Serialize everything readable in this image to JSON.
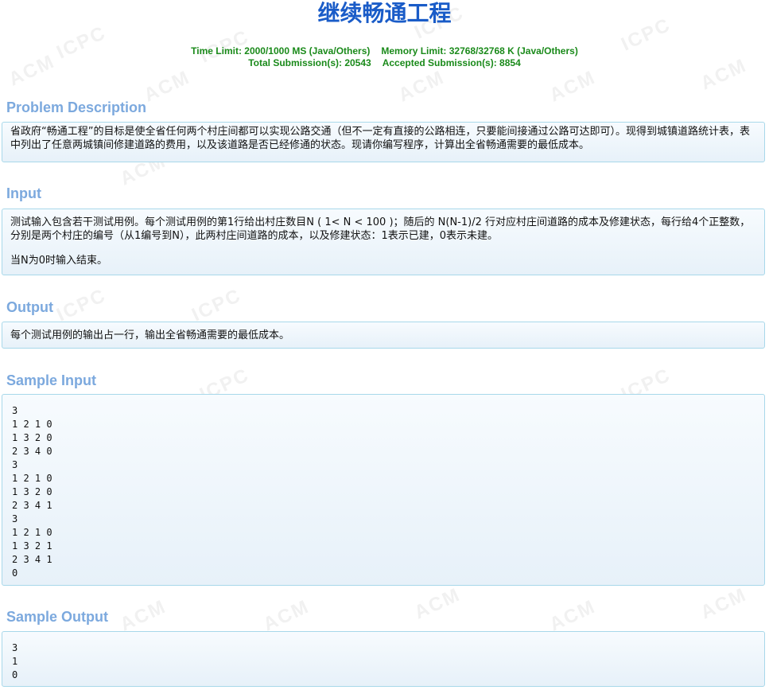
{
  "watermarks": [
    "ICPC",
    "ACM"
  ],
  "problem": {
    "title": "继续畅通工程",
    "limits_line1_a": "Time Limit: 2000/1000 MS (Java/Others)",
    "limits_line1_b": "Memory Limit: 32768/32768 K (Java/Others)",
    "limits_line2_a": "Total Submission(s): 20543",
    "limits_line2_b": "Accepted Submission(s): 8854"
  },
  "sections": {
    "description": {
      "heading": "Problem Description",
      "text": "省政府“畅通工程”的目标是使全省任何两个村庄间都可以实现公路交通（但不一定有直接的公路相连，只要能间接通过公路可达即可）。现得到城镇道路统计表，表中列出了任意两城镇间修建道路的费用，以及该道路是否已经修通的状态。现请你编写程序，计算出全省畅通需要的最低成本。"
    },
    "input": {
      "heading": "Input",
      "paragraph1": "测试输入包含若干测试用例。每个测试用例的第1行给出村庄数目N ( 1< N < 100 )；随后的 N(N-1)/2 行对应村庄间道路的成本及修建状态，每行给4个正整数，分别是两个村庄的编号（从1编号到N），此两村庄间道路的成本，以及修建状态：1表示已建，0表示未建。",
      "paragraph2": "当N为0时输入结束。"
    },
    "output": {
      "heading": "Output",
      "text": "每个测试用例的输出占一行，输出全省畅通需要的最低成本。"
    },
    "sample_input": {
      "heading": "Sample Input",
      "code": "3\n1 2 1 0\n1 3 2 0\n2 3 4 0\n3\n1 2 1 0\n1 3 2 0\n2 3 4 1\n3\n1 2 1 0\n1 3 2 1\n2 3 4 1\n0"
    },
    "sample_output": {
      "heading": "Sample Output",
      "code": "3\n1\n0"
    }
  }
}
